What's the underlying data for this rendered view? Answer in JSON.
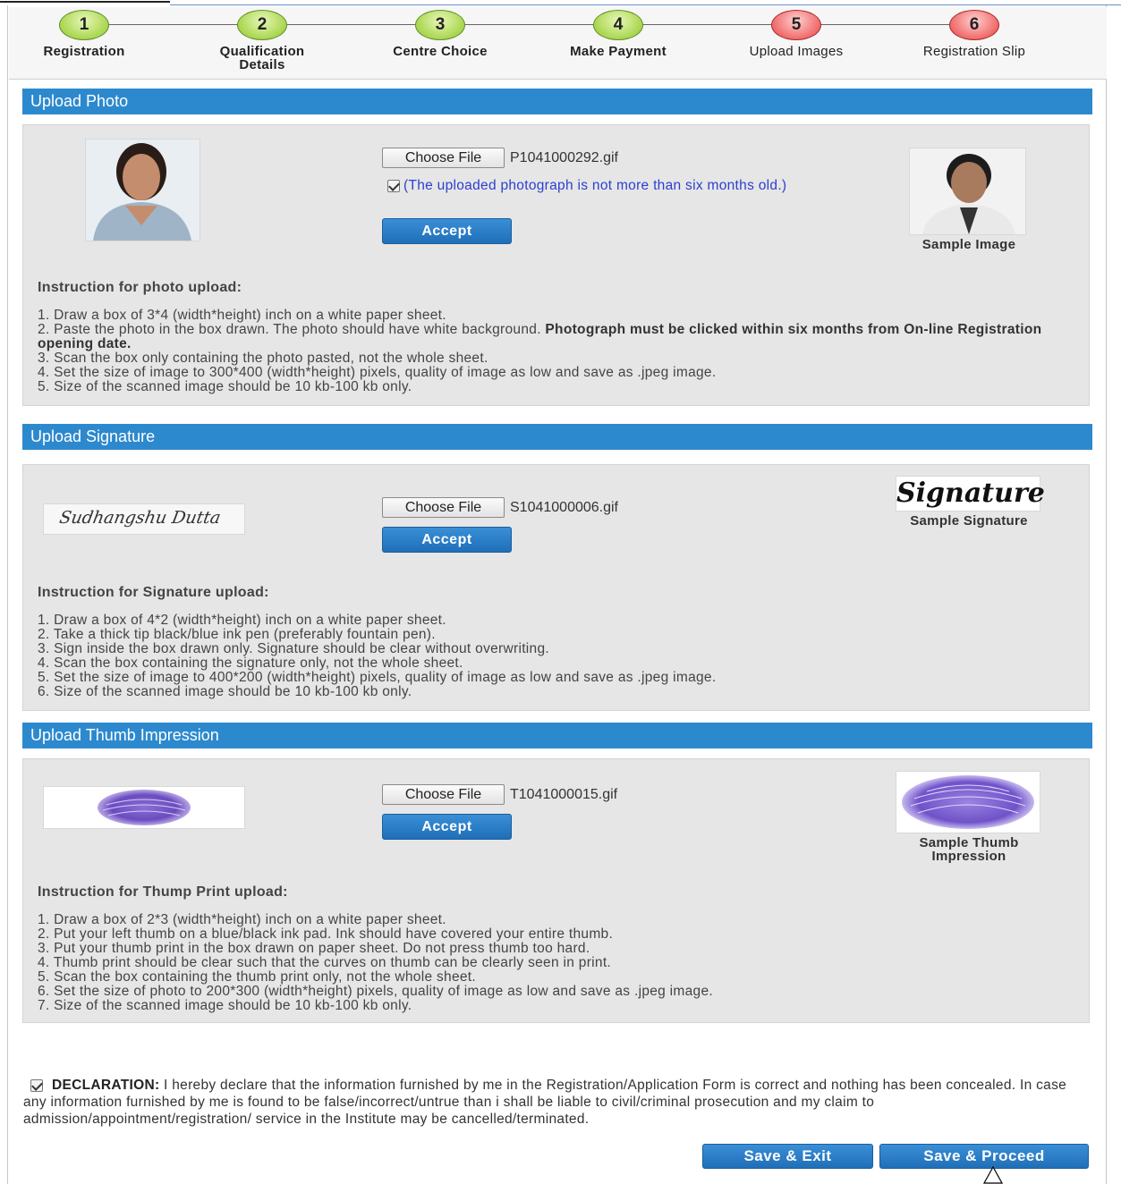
{
  "stepper": {
    "steps": [
      {
        "number": "1",
        "label": "Registration",
        "state": "done"
      },
      {
        "number": "2",
        "label": "Qualification Details",
        "state": "done"
      },
      {
        "number": "3",
        "label": "Centre Choice",
        "state": "done"
      },
      {
        "number": "4",
        "label": "Make Payment",
        "state": "done"
      },
      {
        "number": "5",
        "label": "Upload Images",
        "state": "pending"
      },
      {
        "number": "6",
        "label": "Registration Slip",
        "state": "pending"
      }
    ],
    "colors": {
      "done": "#a9d64f",
      "pending": "#f06a6a"
    }
  },
  "photo": {
    "header": "Upload Photo",
    "choose_label": "Choose File",
    "file_name": "P1041000292.gif",
    "checkbox_text": "(The uploaded photograph is not more than six months old.)",
    "checkbox_checked": true,
    "accept_label": "Accept",
    "sample_caption": "Sample Image",
    "instr_title": "Instruction for photo upload:",
    "instr": [
      "1. Draw a box of 3*4 (width*height) inch on a white paper sheet.",
      "2. Paste the photo in the box drawn. The photo should have white background.",
      "Photograph must be clicked within six months from On-line Registration opening date.",
      "3. Scan the box only containing the photo pasted, not the whole sheet.",
      "4. Set the size of image to 300*400 (width*height) pixels, quality of image as low and save as .jpeg image.",
      "5. Size of the scanned image should be 10 kb-100 kb only."
    ]
  },
  "signature": {
    "header": "Upload Signature",
    "choose_label": "Choose File",
    "file_name": "S1041000006.gif",
    "accept_label": "Accept",
    "uploaded_sig_text": "Sudhangshu Dutta",
    "sample_sig_text": "Signature",
    "sample_caption": "Sample Signature",
    "instr_title": "Instruction for Signature upload:",
    "instr": [
      "1. Draw a box of 4*2 (width*height) inch on a white paper sheet.",
      "2. Take a thick tip black/blue ink pen (preferably fountain pen).",
      "3. Sign inside the box drawn only. Signature should be clear without overwriting.",
      "4. Scan the box containing the signature only, not the whole sheet.",
      "5. Set the size of image to 400*200 (width*height) pixels, quality of image as low and save as .jpeg image.",
      "6. Size of the scanned image should be 10 kb-100 kb only."
    ]
  },
  "thumb": {
    "header": "Upload Thumb Impression",
    "choose_label": "Choose File",
    "file_name": "T1041000015.gif",
    "accept_label": "Accept",
    "sample_caption": "Sample Thumb Impression",
    "instr_title": "Instruction for Thump Print upload:",
    "instr": [
      "1. Draw a box of 2*3 (width*height) inch on a white paper sheet.",
      "2. Put your left thumb on a blue/black ink pad. Ink should have covered your entire thumb.",
      "3. Put your thumb print in the box drawn on paper sheet. Do not press thumb too hard.",
      "4. Thumb print should be clear such that the curves on thumb can be clearly seen in print.",
      "5. Scan the box containing the thumb print only, not the whole sheet.",
      "6. Set the size of photo to 200*300 (width*height) pixels, quality of image as low and save as .jpeg image.",
      "7. Size of the scanned image should be 10 kb-100 kb only."
    ]
  },
  "declaration": {
    "checked": true,
    "label": "DECLARATION:",
    "text": "I hereby declare that the information furnished by me in the Registration/Application Form is correct and nothing has been concealed. In case any information furnished by me is found to be false/incorrect/untrue than i shall be liable to civil/criminal prosecution and my claim to admission/appointment/registration/ service in the Institute may be cancelled/terminated."
  },
  "actions": {
    "save_exit": "Save & Exit",
    "save_proceed": "Save & Proceed"
  }
}
